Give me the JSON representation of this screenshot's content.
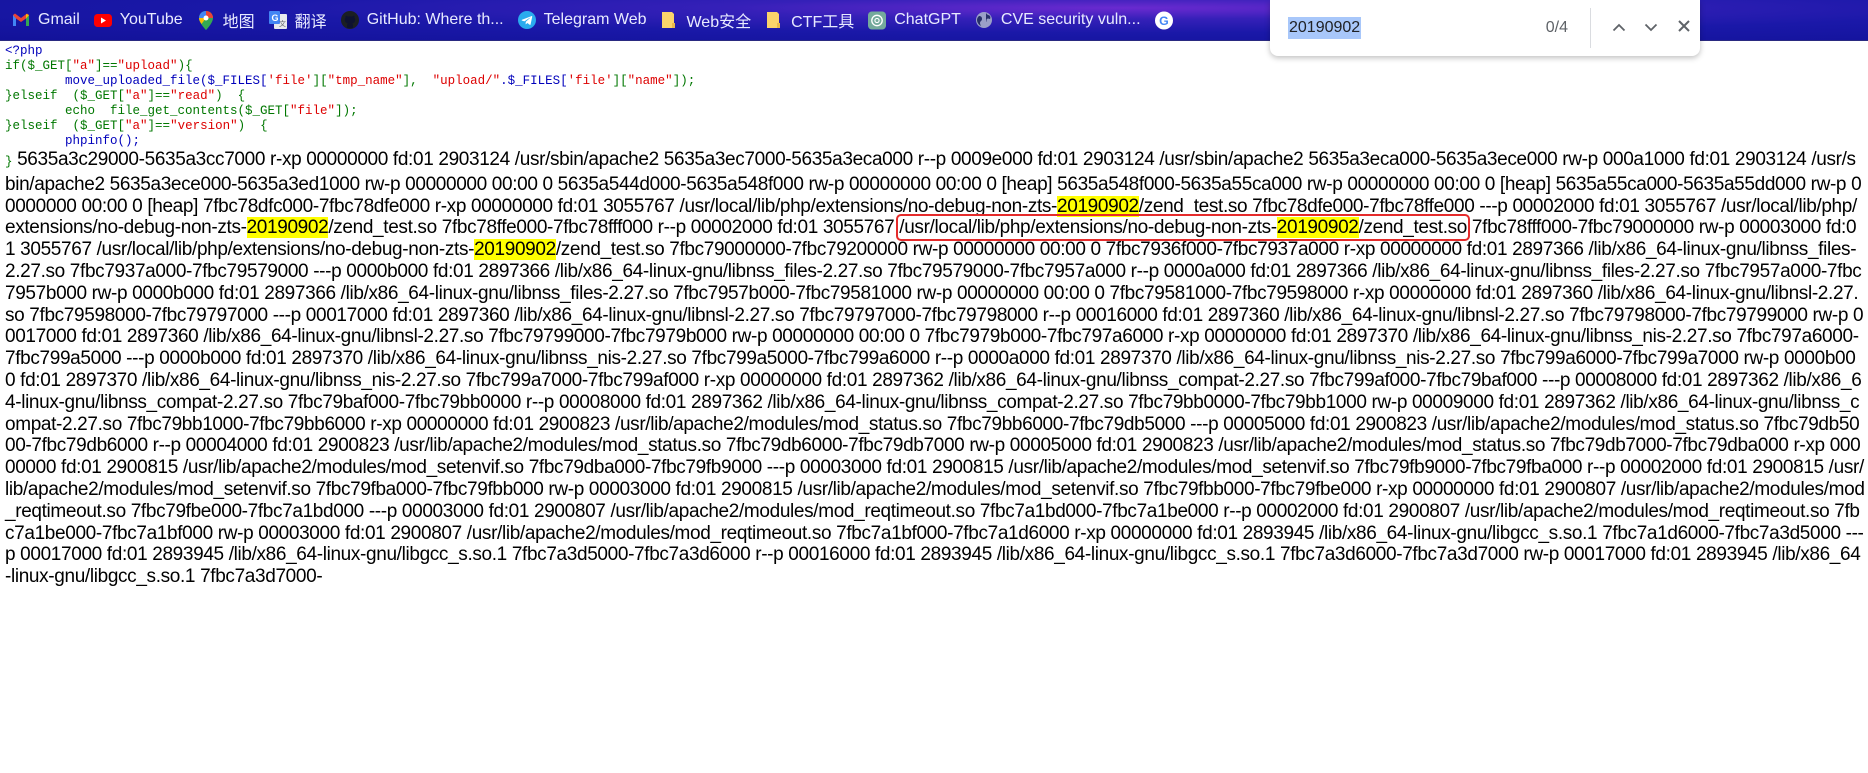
{
  "bookmarks": [
    {
      "label": "Gmail",
      "icon": "gmail-icon"
    },
    {
      "label": "YouTube",
      "icon": "youtube-icon"
    },
    {
      "label": "地图",
      "icon": "maps-icon"
    },
    {
      "label": "翻译",
      "icon": "translate-icon"
    },
    {
      "label": "GitHub: Where th...",
      "icon": "github-icon"
    },
    {
      "label": "Telegram Web",
      "icon": "telegram-icon"
    },
    {
      "label": "Web安全",
      "icon": "folder-icon"
    },
    {
      "label": "CTF工具",
      "icon": "folder-icon"
    },
    {
      "label": "ChatGPT",
      "icon": "chatgpt-icon"
    },
    {
      "label": "CVE security vuln...",
      "icon": "globe-icon"
    },
    {
      "label": "",
      "icon": "google-icon"
    }
  ],
  "find_bar": {
    "query": "20190902",
    "count": "0/4",
    "prev_label": "previous-match",
    "next_label": "next-match",
    "close_label": "close"
  },
  "php_source": {
    "line1": "<?php",
    "line2_a": "if($_GET[",
    "line2_b": "\"a\"",
    "line2_c": "]==",
    "line2_d": "\"upload\"",
    "line2_e": "){",
    "line3_a": "        move_uploaded_file($_FILES[",
    "line3_b": "'file'",
    "line3_c": "][",
    "line3_d": "\"tmp_name\"",
    "line3_e": "],  ",
    "line3_f": "\"upload/\"",
    "line3_g": ".$_FILES[",
    "line3_h": "'file'",
    "line3_i": "][",
    "line3_j": "\"name\"",
    "line3_k": "]);",
    "line4_a": "}elseif  ($_GET[",
    "line4_b": "\"a\"",
    "line4_c": "]==",
    "line4_d": "\"read\"",
    "line4_e": ")  {",
    "line5_a": "        echo  file_get_contents($_GET[",
    "line5_b": "\"file\"",
    "line5_c": "]);",
    "line6_a": "}elseif  ($_GET[",
    "line6_b": "\"a\"",
    "line6_c": "]==",
    "line6_d": "\"version\"",
    "line6_e": ")  {",
    "line7": "        phpinfo();",
    "closing_brace": "}"
  },
  "maps_output": {
    "seg01": " 5635a3c29000-5635a3cc7000 r-xp 00000000 fd:01 2903124 /usr/sbin/apache2 5635a3ec7000-5635a3eca000 r--p 0009e000 fd:01 2903124 /usr/sbin/apache2 5635a3eca000-5635a3ece000 rw-p 000a1000 fd:01 2903124 /usr/sbin/apache2 5635a3ece000-5635a3ed1000 rw-p 00000000 00:00 0 5635a544d000-5635a548f000 rw-p 00000000 00:00 0 [heap] 5635a548f000-5635a55ca000 rw-p 00000000 00:00 0 [heap] 5635a55ca000-5635a55dd000 rw-p 00000000 00:00 0 [heap] 7fbc78dfc000-7fbc78dfe000 r-xp 00000000 fd:01 3055767 /usr/local/lib/php/extensions/no-debug-non-zts-",
    "hl1": "20190902",
    "seg02": "/zend_test.so 7fbc78dfe000-7fbc78ffe000 ---p 00002000 fd:01 3055767 /usr/local/lib/php/extensions/no-debug-non-zts-",
    "hl2": "20190902",
    "seg03": "/zend_test.so 7fbc78ffe000-7fbc78fff000 r--p 00002000 fd:01 3055767 ",
    "boxed_a": "/usr/local/lib/php/extensions/no-debug-non-zts-",
    "hl3": "20190902",
    "boxed_b": "/zend_test.so",
    "seg04": " 7fbc78fff000-7fbc79000000 rw-p 00003000 fd:01 3055767 /usr/local/lib/php/extensions/no-debug-non-zts-",
    "hl4": "20190902",
    "seg05": "/zend_test.so 7fbc79000000-7fbc79200000 rw-p 00000000 00:00 0 7fbc7936f000-7fbc7937a000 r-xp 00000000 fd:01 2897366 /lib/x86_64-linux-gnu/libnss_files-2.27.so 7fbc7937a000-7fbc79579000 ---p 0000b000 fd:01 2897366 /lib/x86_64-linux-gnu/libnss_files-2.27.so 7fbc79579000-7fbc7957a000 r--p 0000a000 fd:01 2897366 /lib/x86_64-linux-gnu/libnss_files-2.27.so 7fbc7957a000-7fbc7957b000 rw-p 0000b000 fd:01 2897366 /lib/x86_64-linux-gnu/libnss_files-2.27.so 7fbc7957b000-7fbc79581000 rw-p 00000000 00:00 0 7fbc79581000-7fbc79598000 r-xp 00000000 fd:01 2897360 /lib/x86_64-linux-gnu/libnsl-2.27.so 7fbc79598000-7fbc79797000 ---p 00017000 fd:01 2897360 /lib/x86_64-linux-gnu/libnsl-2.27.so 7fbc79797000-7fbc79798000 r--p 00016000 fd:01 2897360 /lib/x86_64-linux-gnu/libnsl-2.27.so 7fbc79798000-7fbc79799000 rw-p 00017000 fd:01 2897360 /lib/x86_64-linux-gnu/libnsl-2.27.so 7fbc79799000-7fbc7979b000 rw-p 00000000 00:00 0 7fbc7979b000-7fbc797a6000 r-xp 00000000 fd:01 2897370 /lib/x86_64-linux-gnu/libnss_nis-2.27.so 7fbc797a6000-7fbc799a5000 ---p 0000b000 fd:01 2897370 /lib/x86_64-linux-gnu/libnss_nis-2.27.so 7fbc799a5000-7fbc799a6000 r--p 0000a000 fd:01 2897370 /lib/x86_64-linux-gnu/libnss_nis-2.27.so 7fbc799a6000-7fbc799a7000 rw-p 0000b000 fd:01 2897370 /lib/x86_64-linux-gnu/libnss_nis-2.27.so 7fbc799a7000-7fbc799af000 r-xp 00000000 fd:01 2897362 /lib/x86_64-linux-gnu/libnss_compat-2.27.so 7fbc799af000-7fbc79baf000 ---p 00008000 fd:01 2897362 /lib/x86_64-linux-gnu/libnss_compat-2.27.so 7fbc79baf000-7fbc79bb0000 r--p 00008000 fd:01 2897362 /lib/x86_64-linux-gnu/libnss_compat-2.27.so 7fbc79bb0000-7fbc79bb1000 rw-p 00009000 fd:01 2897362 /lib/x86_64-linux-gnu/libnss_compat-2.27.so 7fbc79bb1000-7fbc79bb6000 r-xp 00000000 fd:01 2900823 /usr/lib/apache2/modules/mod_status.so 7fbc79bb6000-7fbc79db5000 ---p 00005000 fd:01 2900823 /usr/lib/apache2/modules/mod_status.so 7fbc79db5000-7fbc79db6000 r--p 00004000 fd:01 2900823 /usr/lib/apache2/modules/mod_status.so 7fbc79db6000-7fbc79db7000 rw-p 00005000 fd:01 2900823 /usr/lib/apache2/modules/mod_status.so 7fbc79db7000-7fbc79dba000 r-xp 00000000 fd:01 2900815 /usr/lib/apache2/modules/mod_setenvif.so 7fbc79dba000-7fbc79fb9000 ---p 00003000 fd:01 2900815 /usr/lib/apache2/modules/mod_setenvif.so 7fbc79fb9000-7fbc79fba000 r--p 00002000 fd:01 2900815 /usr/lib/apache2/modules/mod_setenvif.so 7fbc79fba000-7fbc79fbb000 rw-p 00003000 fd:01 2900815 /usr/lib/apache2/modules/mod_setenvif.so 7fbc79fbb000-7fbc79fbe000 r-xp 00000000 fd:01 2900807 /usr/lib/apache2/modules/mod_reqtimeout.so 7fbc79fbe000-7fbc7a1bd000 ---p 00003000 fd:01 2900807 /usr/lib/apache2/modules/mod_reqtimeout.so 7fbc7a1bd000-7fbc7a1be000 r--p 00002000 fd:01 2900807 /usr/lib/apache2/modules/mod_reqtimeout.so 7fbc7a1be000-7fbc7a1bf000 rw-p 00003000 fd:01 2900807 /usr/lib/apache2/modules/mod_reqtimeout.so 7fbc7a1bf000-7fbc7a1d6000 r-xp 00000000 fd:01 2893945 /lib/x86_64-linux-gnu/libgcc_s.so.1 7fbc7a1d6000-7fbc7a3d5000 ---p 00017000 fd:01 2893945 /lib/x86_64-linux-gnu/libgcc_s.so.1 7fbc7a3d5000-7fbc7a3d6000 r--p 00016000 fd:01 2893945 /lib/x86_64-linux-gnu/libgcc_s.so.1 7fbc7a3d6000-7fbc7a3d7000 rw-p 00017000 fd:01 2893945 /lib/x86_64-linux-gnu/libgcc_s.so.1 7fbc7a3d7000-"
  },
  "colors": {
    "highlight": "#ffff00",
    "annotation_box": "#e52b2b",
    "find_selection": "#a8c7fa",
    "php_default": "#0000bb",
    "php_keyword": "#007700",
    "php_string": "#dd0000"
  }
}
